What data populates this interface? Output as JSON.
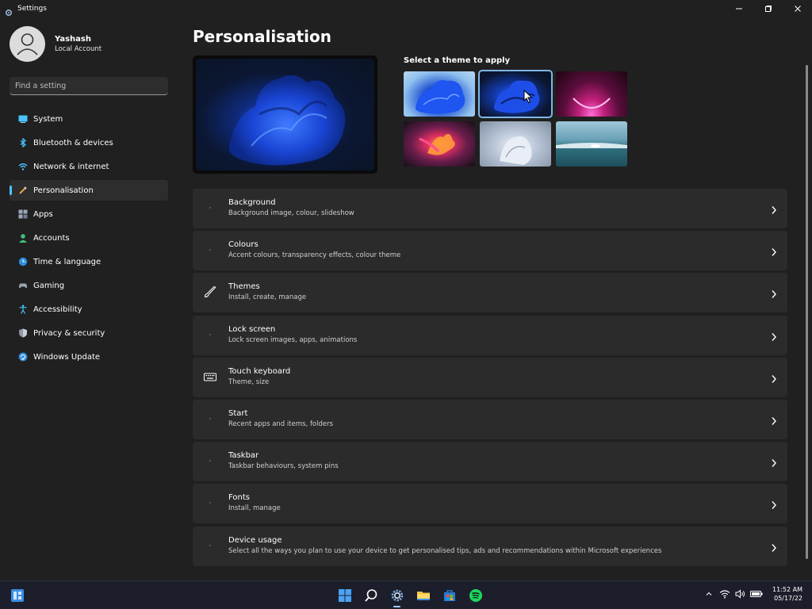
{
  "window": {
    "title": "Settings"
  },
  "profile": {
    "name": "Yashash",
    "account_type": "Local Account"
  },
  "search": {
    "placeholder": "Find a setting"
  },
  "sidebar": {
    "items": [
      {
        "label": "System",
        "icon": "display-icon"
      },
      {
        "label": "Bluetooth & devices",
        "icon": "bluetooth-icon"
      },
      {
        "label": "Network & internet",
        "icon": "wifi-icon"
      },
      {
        "label": "Personalisation",
        "icon": "brush-icon",
        "active": true
      },
      {
        "label": "Apps",
        "icon": "apps-icon"
      },
      {
        "label": "Accounts",
        "icon": "person-icon"
      },
      {
        "label": "Time & language",
        "icon": "clock-globe-icon"
      },
      {
        "label": "Gaming",
        "icon": "gamepad-icon"
      },
      {
        "label": "Accessibility",
        "icon": "accessibility-icon"
      },
      {
        "label": "Privacy & security",
        "icon": "shield-icon"
      },
      {
        "label": "Windows Update",
        "icon": "update-icon"
      }
    ]
  },
  "main": {
    "title": "Personalisation",
    "theme_heading": "Select a theme to apply",
    "selected_theme_index": 1,
    "settings": [
      {
        "title": "Background",
        "subtitle": "Background image, colour, slideshow",
        "icon": ""
      },
      {
        "title": "Colours",
        "subtitle": "Accent colours, transparency effects, colour theme",
        "icon": ""
      },
      {
        "title": "Themes",
        "subtitle": "Install, create, manage",
        "icon": "brush-icon"
      },
      {
        "title": "Lock screen",
        "subtitle": "Lock screen images, apps, animations",
        "icon": ""
      },
      {
        "title": "Touch keyboard",
        "subtitle": "Theme, size",
        "icon": "keyboard-icon"
      },
      {
        "title": "Start",
        "subtitle": "Recent apps and items, folders",
        "icon": ""
      },
      {
        "title": "Taskbar",
        "subtitle": "Taskbar behaviours, system pins",
        "icon": ""
      },
      {
        "title": "Fonts",
        "subtitle": "Install, manage",
        "icon": ""
      },
      {
        "title": "Device usage",
        "subtitle": "Select all the ways you plan to use your device to get personalised tips, ads and recommendations within Microsoft experiences",
        "icon": ""
      }
    ]
  },
  "taskbar": {
    "time": "11:52 AM",
    "date": "05/17/22",
    "apps": [
      "start-icon",
      "search-icon",
      "settings-icon",
      "file-explorer-icon",
      "store-icon",
      "spotify-icon"
    ]
  },
  "colors": {
    "accent": "#4cc2ff",
    "background": "#202020",
    "card": "#2b2b2b"
  }
}
